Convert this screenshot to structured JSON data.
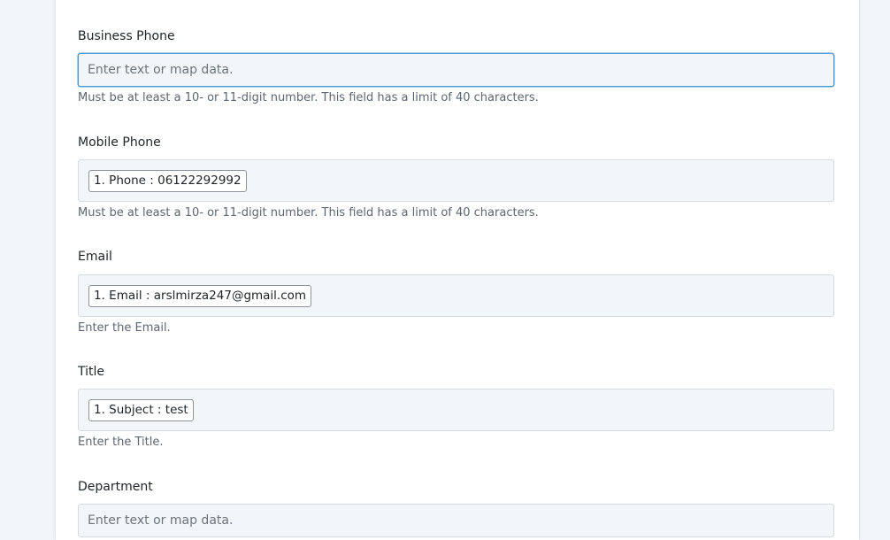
{
  "fields": {
    "business_phone": {
      "label": "Business Phone",
      "placeholder": "Enter text or map data.",
      "help": "Must be at least a 10- or 11-digit number. This field has a limit of 40 characters."
    },
    "mobile_phone": {
      "label": "Mobile Phone",
      "pill": "1. Phone : 06122292992",
      "help": "Must be at least a 10- or 11-digit number. This field has a limit of 40 characters."
    },
    "email": {
      "label": "Email",
      "pill": "1. Email : arslmirza247@gmail.com",
      "help": "Enter the Email."
    },
    "title": {
      "label": "Title",
      "pill": "1. Subject : test",
      "help": "Enter the Title."
    },
    "department": {
      "label": "Department",
      "placeholder": "Enter text or map data."
    }
  },
  "colors": {
    "page_bg": "#f2f5f9",
    "panel_bg": "#ffffff",
    "input_bg": "#f3f6f8",
    "focus_border": "#4e9bd7"
  }
}
